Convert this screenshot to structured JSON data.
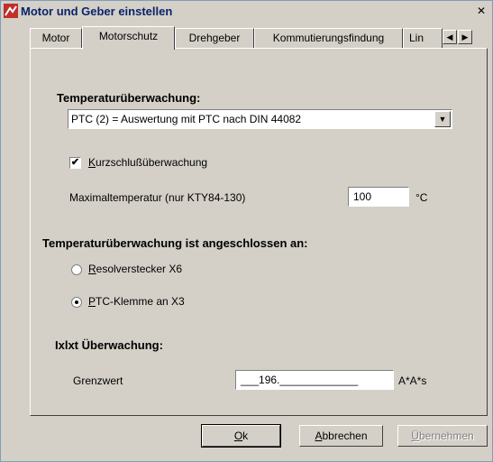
{
  "window": {
    "title": "Motor und Geber einstellen",
    "close_glyph": "✕"
  },
  "tabs": [
    {
      "label": "Motor"
    },
    {
      "label": "Motorschutz"
    },
    {
      "label": "Drehgeber"
    },
    {
      "label": "Kommutierungsfindung"
    },
    {
      "label": "Lin"
    }
  ],
  "tab_scroll": {
    "left": "◀",
    "right": "▶"
  },
  "section_temp": {
    "heading": "Temperaturüberwachung:",
    "select_value": "PTC (2) = Auswertung mit PTC nach DIN 44082",
    "select_arrow": "▼"
  },
  "kurzschluss": {
    "checked": "✔",
    "label_access": "K",
    "label_rest": "urzschlußüberwachung"
  },
  "max_temp": {
    "label": "Maximaltemperatur (nur KTY84-130)",
    "value": "100",
    "unit": "°C"
  },
  "section_connected": {
    "heading": "Temperaturüberwachung ist angeschlossen an:"
  },
  "radio_resolver": {
    "access": "R",
    "rest": "esolverstecker X6"
  },
  "radio_ptc": {
    "access": "P",
    "rest": "TC-Klemme an X3"
  },
  "section_ixt": {
    "heading": "Ixlxt Überwachung:"
  },
  "grenzwert": {
    "label": "Grenzwert",
    "value": "___196._____________",
    "unit": "A*A*s"
  },
  "buttons": {
    "ok_access": "O",
    "ok_rest": "k",
    "cancel_access": "A",
    "cancel_rest": "bbrechen",
    "apply_access": "Ü",
    "apply_rest": "bernehmen"
  }
}
